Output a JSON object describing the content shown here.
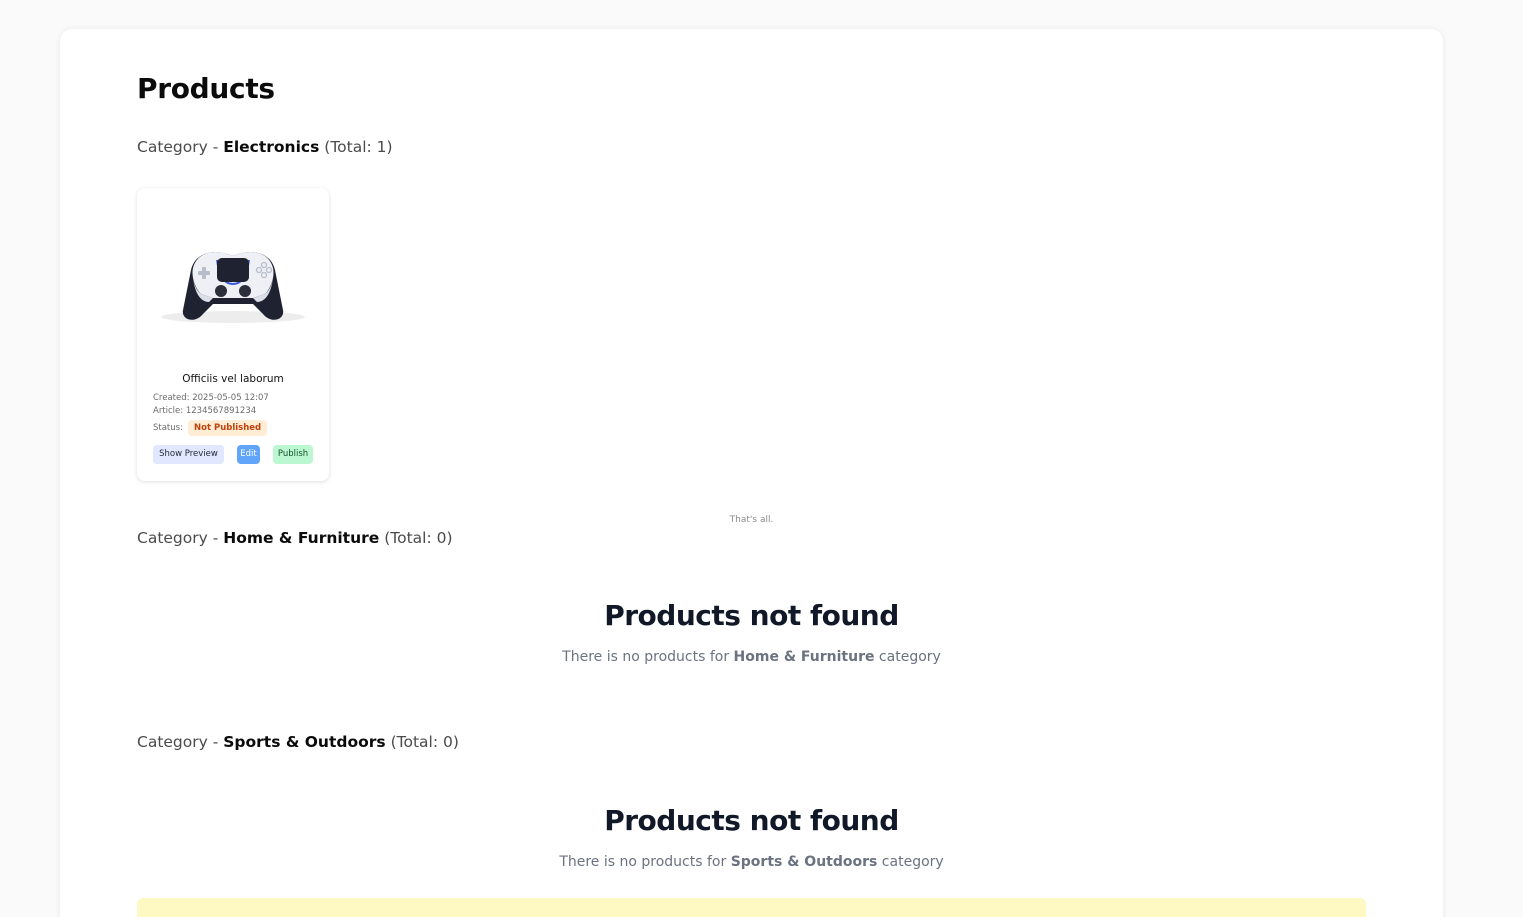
{
  "page": {
    "title": "Products"
  },
  "labels": {
    "category_prefix": "Category - ",
    "total_open": "(Total: ",
    "total_close": ")",
    "created_prefix": "Created: ",
    "article_prefix": "Article: ",
    "status_label": "Status:"
  },
  "categories": [
    {
      "name": "Electronics",
      "total": "1"
    },
    {
      "name": "Home & Furniture",
      "total": "0"
    },
    {
      "name": "Sports & Outdoors",
      "total": "0"
    }
  ],
  "product": {
    "title": "Officiis vel laborum",
    "created": "2025-05-05 12:07",
    "article": "1234567891234",
    "status": "Not Published",
    "image_icon": "gamepad-controller-image",
    "actions": {
      "preview": "Show Preview",
      "edit": "Edit",
      "publish": "Publish"
    }
  },
  "list_end_text": "That's all.",
  "empty_state": {
    "title": "Products not found",
    "text_before": "There is no products for ",
    "text_after": " category"
  },
  "colors": {
    "status_badge_bg": "#ffedd5",
    "status_badge_text": "#c2410c",
    "edit_button": "#60a5fa",
    "publish_button": "#bbf7d0",
    "preview_button": "#e0e7ff",
    "notice_bar": "#fef9c3"
  }
}
